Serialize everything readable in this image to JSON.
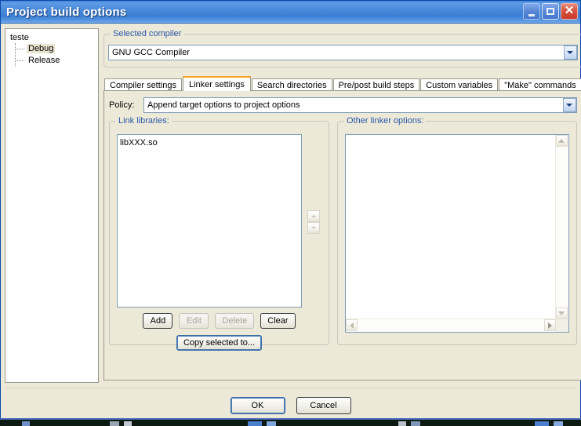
{
  "window": {
    "title": "Project build options",
    "buttons": {
      "minimize": "minimize",
      "maximize": "maximize",
      "close": "✕"
    }
  },
  "tree": {
    "root": "teste",
    "items": [
      {
        "label": "Debug",
        "selected": true
      },
      {
        "label": "Release",
        "selected": false
      }
    ]
  },
  "compiler_group": {
    "title": "Selected compiler",
    "selected": "GNU GCC Compiler"
  },
  "tabs": [
    {
      "label": "Compiler settings",
      "active": false
    },
    {
      "label": "Linker settings",
      "active": true
    },
    {
      "label": "Search directories",
      "active": false
    },
    {
      "label": "Pre/post build steps",
      "active": false
    },
    {
      "label": "Custom variables",
      "active": false
    },
    {
      "label": "\"Make\" commands",
      "active": false
    }
  ],
  "policy": {
    "label": "Policy:",
    "selected": "Append target options to project options"
  },
  "link_libraries": {
    "title": "Link libraries:",
    "items": [
      "libXXX.so"
    ],
    "buttons": [
      {
        "label": "Add",
        "enabled": true
      },
      {
        "label": "Edit",
        "enabled": false
      },
      {
        "label": "Delete",
        "enabled": false
      },
      {
        "label": "Clear",
        "enabled": true
      }
    ],
    "copy_button": "Copy selected to..."
  },
  "other_linker_options": {
    "title": "Other linker options:",
    "value": ""
  },
  "footer": {
    "ok": "OK",
    "cancel": "Cancel"
  },
  "colors": {
    "title_bar_blue": "#4a8ada",
    "window_background": "#ece9d8",
    "group_label_blue": "#2b57a8",
    "active_tab_accent": "#f5a623",
    "close_button_red": "#c73a28",
    "selection_highlight": "#e8e4cf"
  }
}
